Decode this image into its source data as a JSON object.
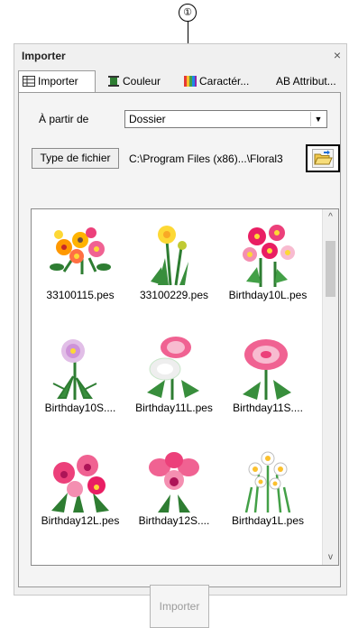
{
  "callout": {
    "number": "①"
  },
  "window": {
    "title": "Importer",
    "close_symbol": "×"
  },
  "tabs": [
    {
      "label": "Importer",
      "active": true,
      "icon": "import-grid-icon"
    },
    {
      "label": "Couleur",
      "active": false,
      "icon": "thread-spool-icon"
    },
    {
      "label": "Caractér...",
      "active": false,
      "icon": "color-stripes-icon"
    },
    {
      "label": "AB Attribut...",
      "active": false,
      "icon": "text-attribute-icon"
    }
  ],
  "source": {
    "label": "À partir de",
    "selected": "Dossier",
    "arrow": "▼"
  },
  "filetype_button": "Type de fichier",
  "folder_path": "C:\\Program Files (x86)...\\Floral3",
  "files": [
    {
      "name": "33100115.pes",
      "icon": "orange-pink-flowers-icon"
    },
    {
      "name": "33100229.pes",
      "icon": "yellow-dandelion-icon"
    },
    {
      "name": "Birthday10L.pes",
      "icon": "pink-cosmos-icon"
    },
    {
      "name": "Birthday10S....",
      "icon": "pink-aster-icon"
    },
    {
      "name": "Birthday11L.pes",
      "icon": "pink-white-chrysanthemum-icon"
    },
    {
      "name": "Birthday11S....",
      "icon": "pink-chrysanthemum-icon"
    },
    {
      "name": "Birthday12L.pes",
      "icon": "pink-orchids-icon"
    },
    {
      "name": "Birthday12S....",
      "icon": "pink-orchid-icon"
    },
    {
      "name": "Birthday1L.pes",
      "icon": "white-daffodils-icon"
    }
  ],
  "scroll": {
    "up": "^",
    "down": "v"
  },
  "import_button": {
    "label": "Importer",
    "enabled": false
  },
  "colors": {
    "highlight_frame": "#000000",
    "disabled_text": "#9b9b9b"
  }
}
